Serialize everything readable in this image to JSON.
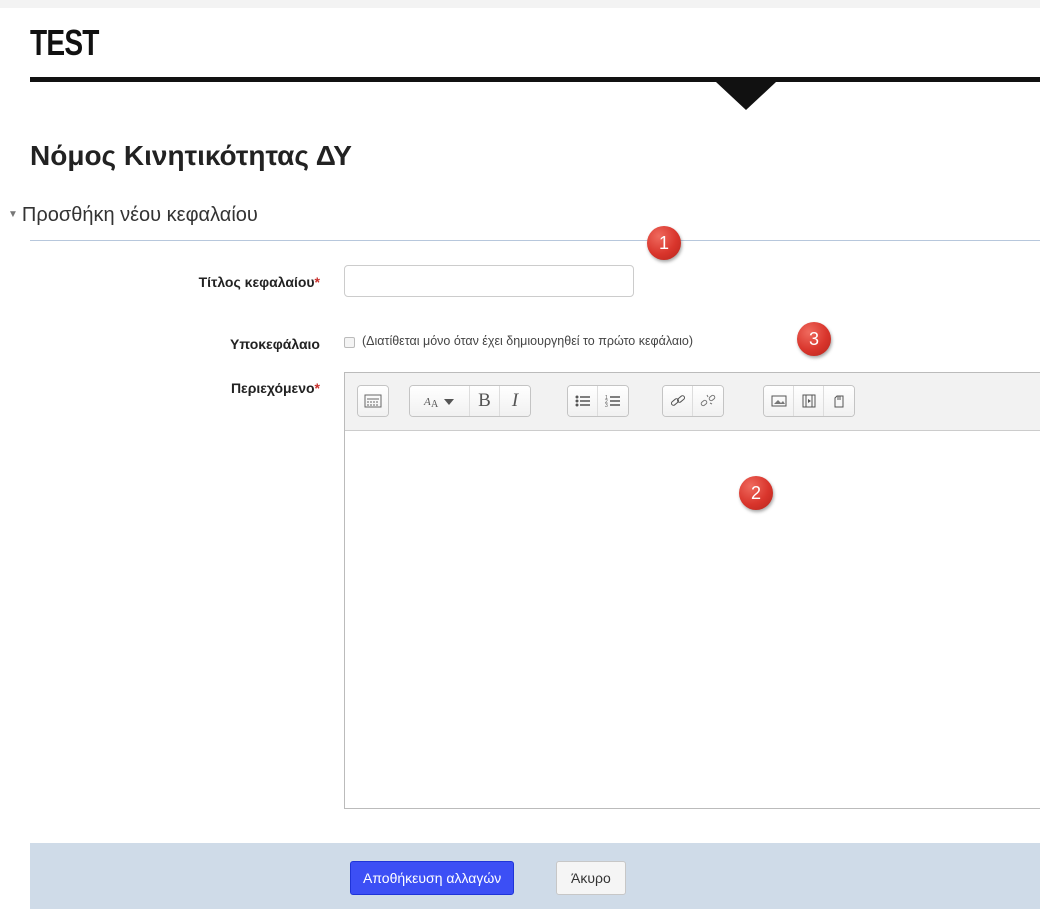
{
  "header": {
    "site_title": "TEST"
  },
  "page": {
    "heading": "Νόμος Κινητικότητας ΔΥ",
    "section_legend": "Προσθήκη νέου κεφαλαίου"
  },
  "form": {
    "chapter_title_label": "Τίτλος κεφαλαίου",
    "chapter_title_value": "",
    "required_mark": "*",
    "subchapter_label": "Υποκεφάλαιο",
    "subchapter_note": "(Διατίθεται μόνο όταν έχει δημιουργηθεί το πρώτο κεφάλαιο)",
    "subchapter_checked": false,
    "content_label": "Περιεχόμενο",
    "content_value": ""
  },
  "editor_toolbar": {
    "groups": [
      [
        "toolbar-toggle-icon"
      ],
      [
        "font-style-icon",
        "bold-icon",
        "italic-icon"
      ],
      [
        "unordered-list-icon",
        "ordered-list-icon"
      ],
      [
        "link-icon",
        "unlink-icon"
      ],
      [
        "image-icon",
        "media-icon",
        "manage-files-icon"
      ]
    ],
    "bold_glyph": "B",
    "italic_glyph": "I"
  },
  "badges": {
    "one": "1",
    "two": "2",
    "three": "3"
  },
  "buttons": {
    "save": "Αποθήκευση αλλαγών",
    "cancel": "Άκυρο"
  },
  "colors": {
    "save_button": "#3c4ff5",
    "badge": "#d9352c",
    "footer": "#cfdbe8",
    "required": "#c9302c"
  }
}
